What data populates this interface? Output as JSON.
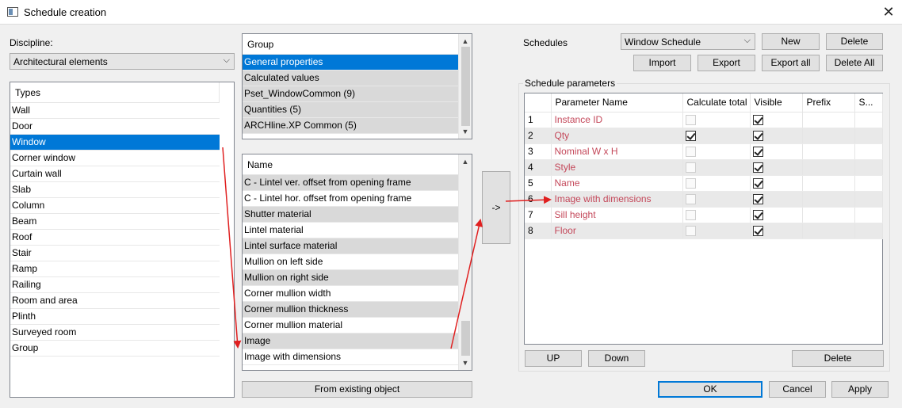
{
  "window": {
    "title": "Schedule creation",
    "close": "✕"
  },
  "discipline": {
    "label": "Discipline:",
    "value": "Architectural elements",
    "arrow": "⌵"
  },
  "types": {
    "header": "Types",
    "items": [
      "Wall",
      "Door",
      "Window",
      "Corner window",
      "Curtain wall",
      "Slab",
      "Column",
      "Beam",
      "Roof",
      "Stair",
      "Ramp",
      "Railing",
      "Room and area",
      "Plinth",
      "Surveyed room",
      "Group"
    ],
    "selected_index": 2
  },
  "groups": {
    "header": "Group",
    "items": [
      "General properties",
      "Calculated values",
      "Pset_WindowCommon (9)",
      "Quantities (5)",
      "ARCHline.XP Common (5)"
    ],
    "selected_index": 0
  },
  "names": {
    "header": "Name",
    "items": [
      "C - Lintel ver. offset from opening frame",
      "C - Lintel hor. offset from opening frame",
      "Shutter material",
      "Lintel material",
      "Lintel surface material",
      "Mullion on left side",
      "Mullion on right side",
      "Corner mullion width",
      "Corner mullion thickness",
      "Corner mullion material",
      "Image",
      "Image with dimensions"
    ]
  },
  "transfer_button": "->",
  "from_existing_button": "From existing object",
  "schedules": {
    "label": "Schedules",
    "value": "Window Schedule",
    "arrow": "⌵",
    "new_button": "New",
    "delete_button": "Delete",
    "import_button": "Import",
    "export_button": "Export",
    "export_all_button": "Export all",
    "delete_all_button": "Delete All"
  },
  "params": {
    "group_label": "Schedule parameters",
    "columns": [
      "Parameter Name",
      "Calculate total",
      "Visible",
      "Prefix",
      "S..."
    ],
    "rows": [
      {
        "num": "1",
        "name": "Instance ID",
        "total": "disabled",
        "visible": true
      },
      {
        "num": "2",
        "name": "Qty",
        "total": "checked",
        "visible": true
      },
      {
        "num": "3",
        "name": "Nominal W x H",
        "total": "disabled",
        "visible": true
      },
      {
        "num": "4",
        "name": "Style",
        "total": "disabled",
        "visible": true
      },
      {
        "num": "5",
        "name": "Name",
        "total": "disabled",
        "visible": true
      },
      {
        "num": "6",
        "name": "Image with dimensions",
        "total": "disabled",
        "visible": true
      },
      {
        "num": "7",
        "name": "Sill height",
        "total": "disabled",
        "visible": true
      },
      {
        "num": "8",
        "name": "Floor",
        "total": "disabled",
        "visible": true
      }
    ],
    "up_button": "UP",
    "down_button": "Down",
    "delete_button": "Delete"
  },
  "footer": {
    "ok": "OK",
    "cancel": "Cancel",
    "apply": "Apply"
  },
  "colors": {
    "selection": "#0078d7",
    "param_text": "#c4485a",
    "annotation_arrow": "#e02020"
  }
}
